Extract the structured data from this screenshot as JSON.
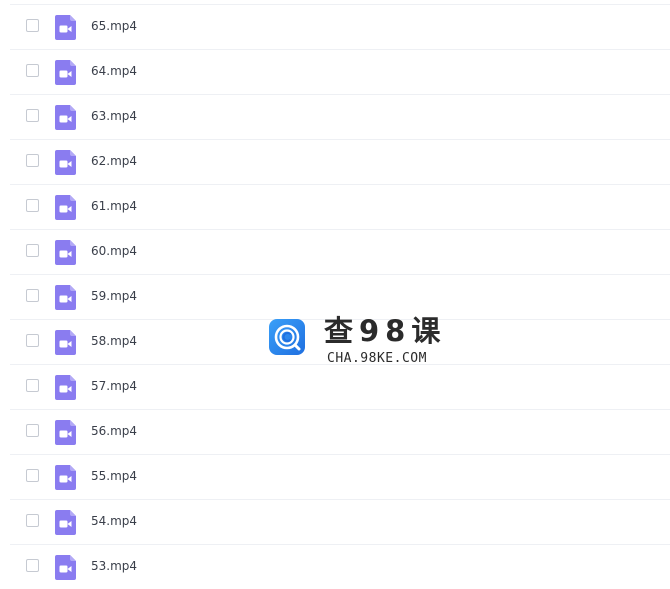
{
  "files": [
    {
      "name": "65.mp4"
    },
    {
      "name": "64.mp4"
    },
    {
      "name": "63.mp4"
    },
    {
      "name": "62.mp4"
    },
    {
      "name": "61.mp4"
    },
    {
      "name": "60.mp4"
    },
    {
      "name": "59.mp4"
    },
    {
      "name": "58.mp4"
    },
    {
      "name": "57.mp4"
    },
    {
      "name": "56.mp4"
    },
    {
      "name": "55.mp4"
    },
    {
      "name": "54.mp4"
    },
    {
      "name": "53.mp4"
    }
  ],
  "file_icon": "video-file-icon",
  "colors": {
    "icon_purple": "#8a7cf0",
    "divider": "#eef0f4",
    "watermark_blue": "#2f8cf0"
  },
  "watermark": {
    "title": "查98课",
    "subtitle": "CHA.98KE.COM",
    "logo_icon": "cha98ke-logo-icon"
  }
}
